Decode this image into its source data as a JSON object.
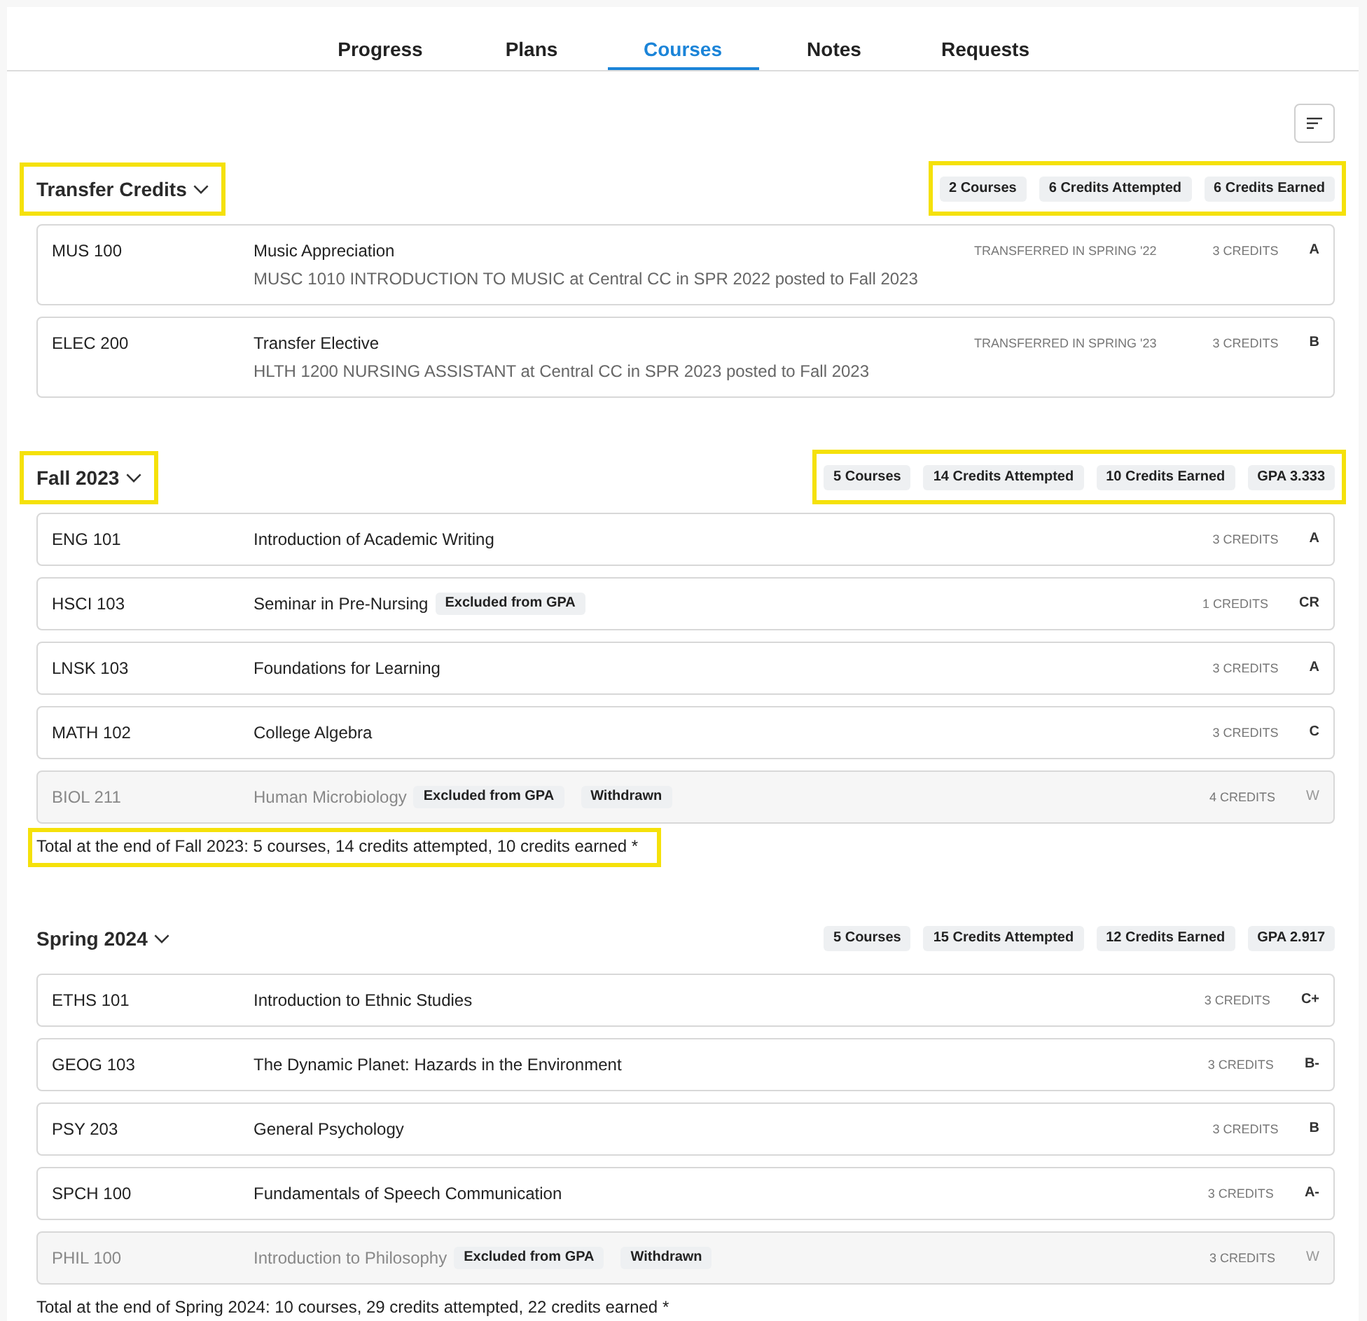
{
  "tabs": [
    {
      "label": "Progress",
      "selected": false
    },
    {
      "label": "Plans",
      "selected": false
    },
    {
      "label": "Courses",
      "selected": true
    },
    {
      "label": "Notes",
      "selected": false
    },
    {
      "label": "Requests",
      "selected": false
    }
  ],
  "sections": [
    {
      "title": "Transfer Credits",
      "expanded": true,
      "title_highlighted": true,
      "stats_highlighted": true,
      "stats": [
        "2 Courses",
        "6 Credits Attempted",
        "6 Credits Earned"
      ],
      "courses": [
        {
          "code": "MUS 100",
          "title": "Music Appreciation",
          "detail": "MUSC 1010 INTRODUCTION TO MUSIC at Central CC in SPR 2022 posted to Fall 2023",
          "transfer_note": "TRANSFERRED IN SPRING '22",
          "credits": "3 CREDITS",
          "grade": "A",
          "inactive": false
        },
        {
          "code": "ELEC 200",
          "title": "Transfer Elective",
          "detail": "HLTH 1200 NURSING ASSISTANT at Central CC in SPR 2023 posted to Fall 2023",
          "transfer_note": "TRANSFERRED IN SPRING '23",
          "credits": "3 CREDITS",
          "grade": "B",
          "inactive": false
        }
      ]
    },
    {
      "title": "Fall 2023",
      "expanded": true,
      "title_highlighted": true,
      "stats_highlighted": true,
      "stats": [
        "5 Courses",
        "14 Credits Attempted",
        "10 Credits Earned",
        "GPA 3.333"
      ],
      "courses": [
        {
          "code": "ENG 101",
          "title": "Introduction of Academic Writing",
          "credits": "3 CREDITS",
          "grade": "A",
          "inactive": false
        },
        {
          "code": "HSCI 103",
          "title": "Seminar in Pre-Nursing",
          "tags": [
            "Excluded from GPA"
          ],
          "credits": "1 CREDITS",
          "grade": "CR",
          "inactive": false
        },
        {
          "code": "LNSK 103",
          "title": "Foundations for Learning",
          "credits": "3 CREDITS",
          "grade": "A",
          "inactive": false
        },
        {
          "code": "MATH 102",
          "title": "College Algebra",
          "credits": "3 CREDITS",
          "grade": "C",
          "inactive": false
        },
        {
          "code": "BIOL 211",
          "title": "Human Microbiology",
          "tags": [
            "Excluded from GPA",
            "Withdrawn"
          ],
          "credits": "4 CREDITS",
          "grade": "W",
          "inactive": true
        }
      ],
      "total": {
        "text": "Total at the end of Fall 2023: 5 courses, 14 credits attempted, 10 credits earned *",
        "highlighted": true
      }
    },
    {
      "title": "Spring 2024",
      "expanded": true,
      "title_highlighted": false,
      "stats_highlighted": false,
      "stats": [
        "5 Courses",
        "15 Credits Attempted",
        "12 Credits Earned",
        "GPA 2.917"
      ],
      "courses": [
        {
          "code": "ETHS 101",
          "title": "Introduction to Ethnic Studies",
          "credits": "3 CREDITS",
          "grade": "C+",
          "inactive": false
        },
        {
          "code": "GEOG 103",
          "title": "The Dynamic Planet: Hazards in the Environment",
          "credits": "3 CREDITS",
          "grade": "B-",
          "inactive": false
        },
        {
          "code": "PSY 203",
          "title": "General Psychology",
          "credits": "3 CREDITS",
          "grade": "B",
          "inactive": false
        },
        {
          "code": "SPCH 100",
          "title": "Fundamentals of Speech Communication",
          "credits": "3 CREDITS",
          "grade": "A-",
          "inactive": false
        },
        {
          "code": "PHIL 100",
          "title": "Introduction to Philosophy",
          "tags": [
            "Excluded from GPA",
            "Withdrawn"
          ],
          "credits": "3 CREDITS",
          "grade": "W",
          "inactive": true
        }
      ],
      "total": {
        "text": "Total at the end of Spring 2024: 10 courses, 29 credits attempted, 22 credits earned *",
        "highlighted": false
      }
    }
  ]
}
